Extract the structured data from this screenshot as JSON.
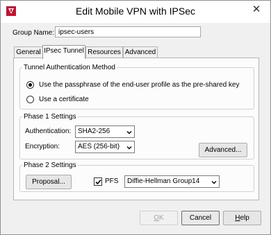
{
  "window": {
    "title": "Edit Mobile VPN with IPSec",
    "close_glyph": "✕"
  },
  "group": {
    "label": "Group Name:",
    "value": "ipsec-users"
  },
  "tabs": [
    {
      "label": "General"
    },
    {
      "label": "IPsec Tunnel",
      "active": true
    },
    {
      "label": "Resources"
    },
    {
      "label": "Advanced"
    }
  ],
  "tunnel_auth": {
    "legend": "Tunnel Authentication Method",
    "options": [
      {
        "label": "Use the passphrase of the end-user profile as the pre-shared key",
        "selected": true
      },
      {
        "label": "Use a certificate",
        "selected": false
      }
    ]
  },
  "phase1": {
    "legend": "Phase 1 Settings",
    "auth_label": "Authentication:",
    "auth_value": "SHA2-256",
    "enc_label": "Encryption:",
    "enc_value": "AES (256-bit)",
    "advanced_button": "Advanced..."
  },
  "phase2": {
    "legend": "Phase 2 Settings",
    "proposal_button": "Proposal...",
    "pfs_label": "PFS",
    "pfs_checked": true,
    "dh_value": "Diffie-Hellman Group14"
  },
  "footer": {
    "ok_mnemonic": "O",
    "ok_rest": "K",
    "cancel_label": "Cancel",
    "help_mnemonic": "H",
    "help_rest": "elp"
  },
  "icons": {
    "app": "watchguard-logo-icon",
    "close": "close-icon",
    "chevron": "chevron-down-icon",
    "check": "checkmark-icon"
  },
  "colors": {
    "brand_red": "#c8102e",
    "window_bg": "#f0f0f0",
    "panel_bg": "#fcfcfc"
  }
}
